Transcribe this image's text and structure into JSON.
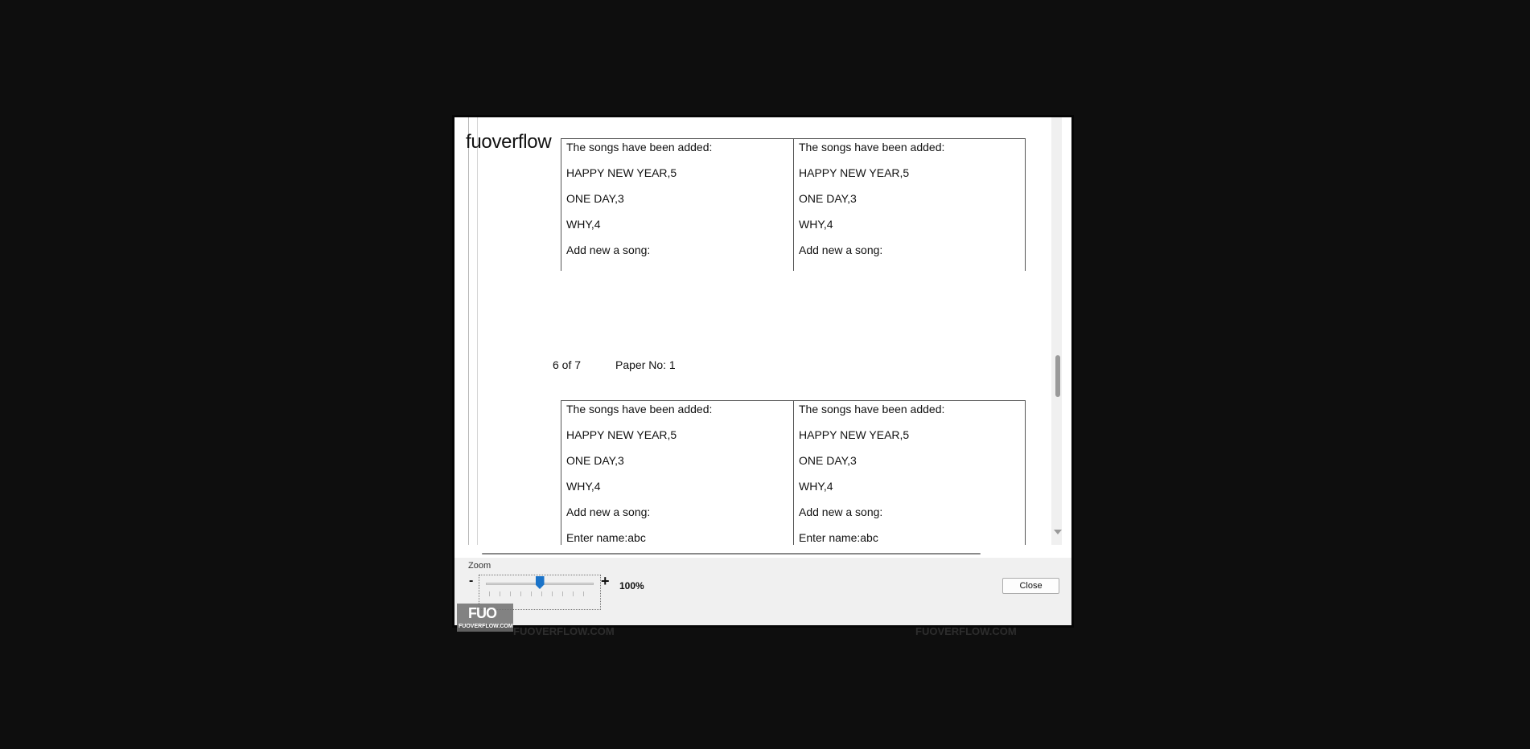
{
  "site_name": "fuoverflow",
  "pages": {
    "top_block": {
      "left": [
        "The songs have been added:",
        "HAPPY NEW YEAR,5",
        "ONE DAY,3",
        "WHY,4",
        "Add new a song:"
      ],
      "right": [
        "The songs have been added:",
        "HAPPY NEW YEAR,5",
        "ONE DAY,3",
        "WHY,4",
        "Add new a song:"
      ]
    },
    "page_number": "6 of 7",
    "paper_no": "Paper No: 1",
    "bottom_block": {
      "left": [
        "The songs have been added:",
        "HAPPY NEW YEAR,5",
        "ONE DAY,3",
        "WHY,4",
        "Add new a song:",
        "Enter name:abc"
      ],
      "right": [
        "The songs have been added:",
        "HAPPY NEW YEAR,5",
        "ONE DAY,3",
        "WHY,4",
        "Add new a song:",
        "Enter name:abc"
      ]
    }
  },
  "zoom": {
    "label": "Zoom",
    "minus": "-",
    "plus": "+",
    "value": "100%",
    "level_fraction": 0.5
  },
  "buttons": {
    "close_label": "Close"
  },
  "watermark": {
    "logo_mark": "FUO",
    "logo_text": "FUOVERFLOW.COM",
    "footer_left": "FUOVERFLOW.COM",
    "footer_right": "FUOVERFLOW.COM"
  },
  "colors": {
    "slider_thumb": "#1a73c9",
    "background": "#0e0e0e"
  }
}
